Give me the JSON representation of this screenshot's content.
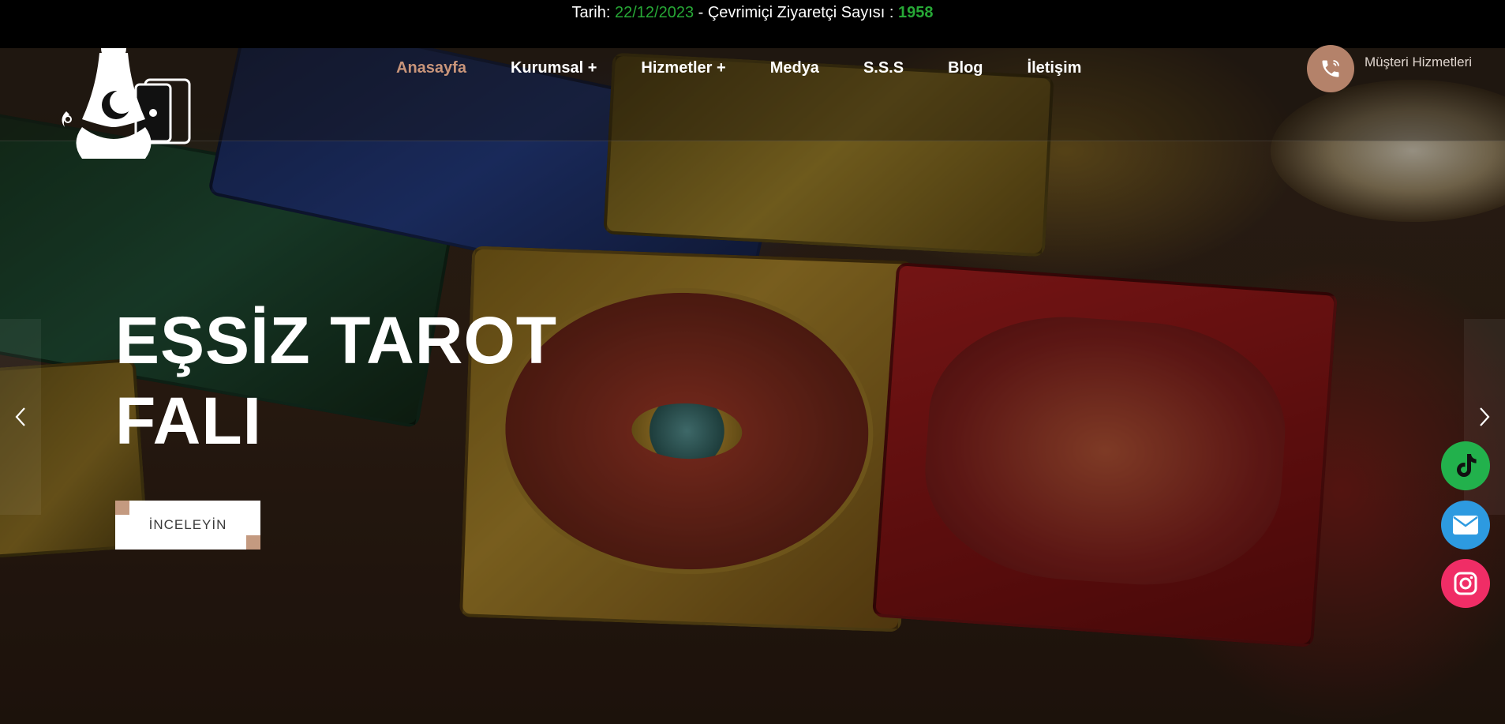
{
  "topbar": {
    "date_label": "Tarih:",
    "date_value": "22/12/2023",
    "visitors_label": " - Çevrimiçi Ziyaretçi Sayısı : ",
    "visitors_value": "1958"
  },
  "nav": {
    "items": [
      {
        "label": "Anasayfa",
        "active": true
      },
      {
        "label": "Kurumsal +",
        "active": false
      },
      {
        "label": "Hizmetler +",
        "active": false
      },
      {
        "label": "Medya",
        "active": false
      },
      {
        "label": "S.S.S",
        "active": false
      },
      {
        "label": "Blog",
        "active": false
      },
      {
        "label": "İletişim",
        "active": false
      }
    ],
    "support_label": "Müşteri Hizmetleri",
    "support_icon": "phone-icon"
  },
  "hero": {
    "title_line1": "EŞSİZ TAROT",
    "title_line2": "FALI",
    "cta_label": "İNCELEYİN"
  },
  "slider": {
    "prev_icon": "chevron-left-icon",
    "next_icon": "chevron-right-icon"
  },
  "social": [
    {
      "name": "tiktok-icon",
      "color": "#22b14c"
    },
    {
      "name": "mail-icon",
      "color": "#2d9ae0"
    },
    {
      "name": "instagram-icon",
      "color": "#f02d66"
    }
  ],
  "colors": {
    "accent": "#c9957a",
    "topbar_green": "#27a836",
    "support_circle": "#b4826a"
  }
}
